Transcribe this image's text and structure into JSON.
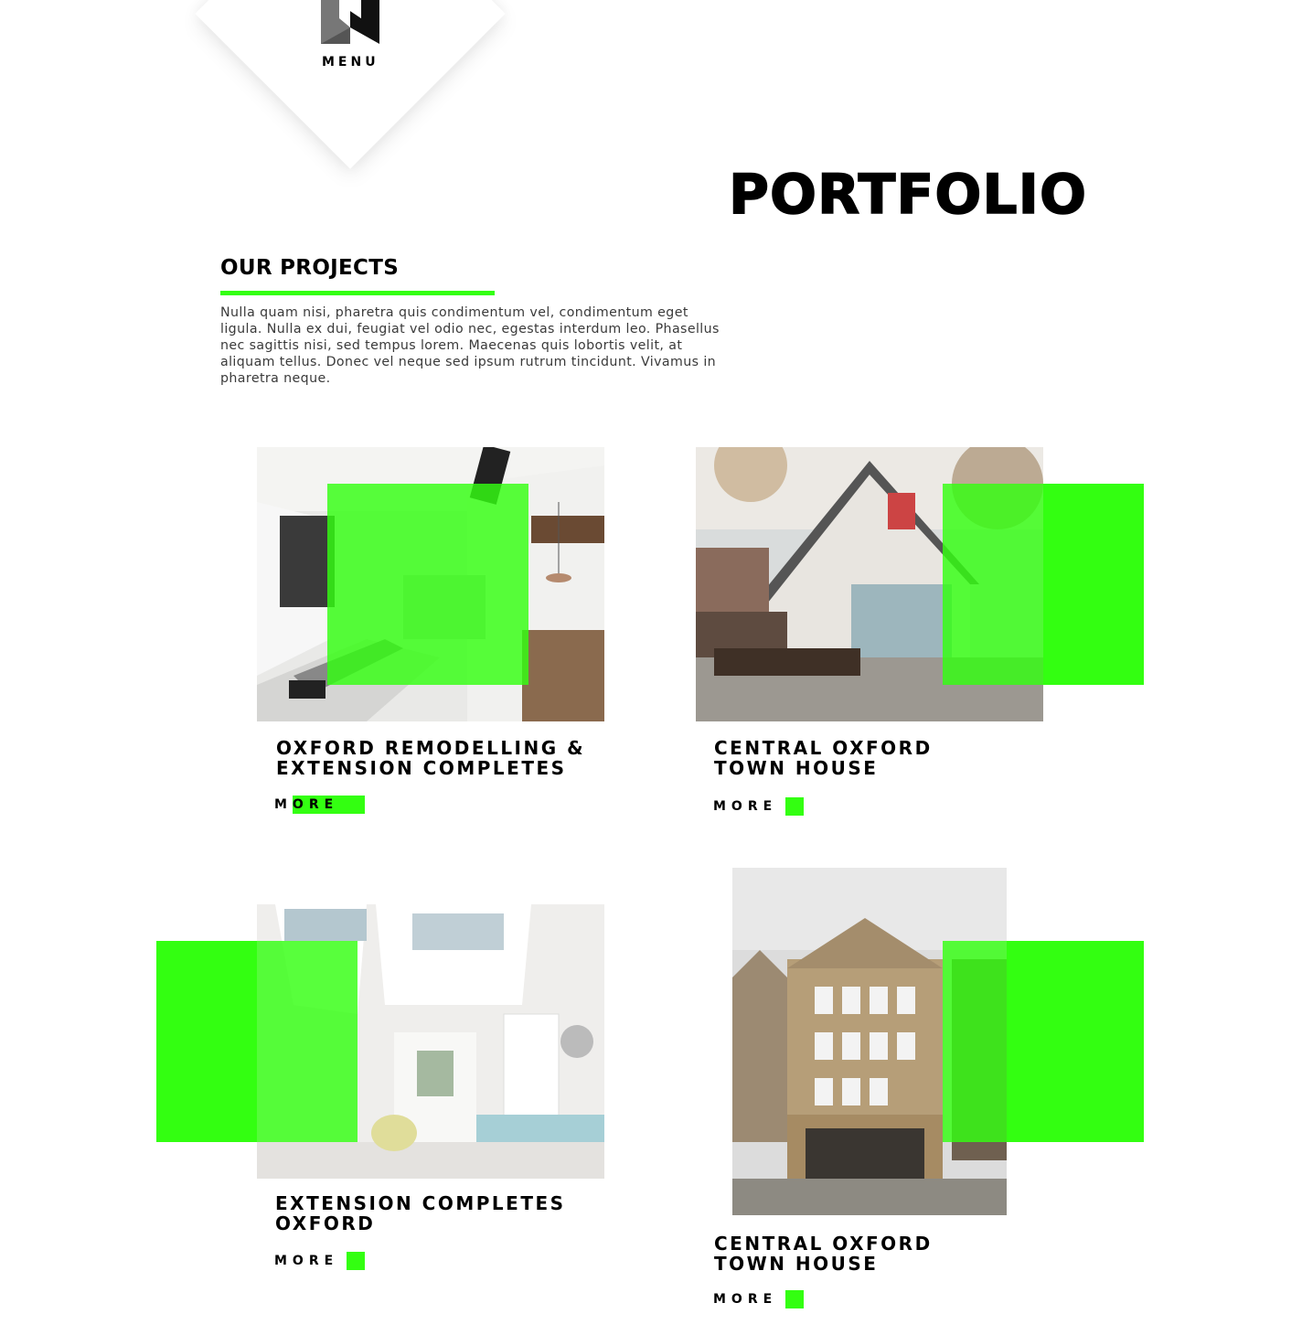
{
  "colors": {
    "accent": "#33ff11",
    "text": "#000000",
    "body_text": "#3a3a3a",
    "logo_dark": "#111111",
    "logo_grey": "#777777"
  },
  "header": {
    "logo_icon": "w-ribbon-logo-icon",
    "menu_label": "MENU"
  },
  "page": {
    "title": "PORTFOLIO",
    "section_heading": "OUR PROJECTS",
    "intro": "Nulla quam nisi, pharetra quis condimentum vel, condimentum eget ligula. Nulla ex dui, feugiat vel odio nec, egestas interdum leo. Phasellus nec sagittis nisi, sed tempus lorem. Maecenas quis lobortis velit, at aliquam tellus. Donec vel neque sed ipsum rutrum tincidunt. Vivamus in pharetra neque."
  },
  "projects": [
    {
      "title_line1": "OXFORD REMODELLING &",
      "title_line2": "EXTENSION COMPLETES",
      "more": "MORE",
      "image": "kitchen-interior-photo"
    },
    {
      "title_line1": "CENTRAL OXFORD",
      "title_line2": "TOWN HOUSE",
      "more": "MORE",
      "image": "house-exterior-photo"
    },
    {
      "title_line1": "EXTENSION COMPLETES",
      "title_line2": "OXFORD",
      "more": "MORE",
      "image": "living-room-interior-photo"
    },
    {
      "title_line1": "CENTRAL OXFORD",
      "title_line2": "TOWN HOUSE",
      "more": "MORE",
      "image": "brick-townhouse-photo"
    }
  ]
}
